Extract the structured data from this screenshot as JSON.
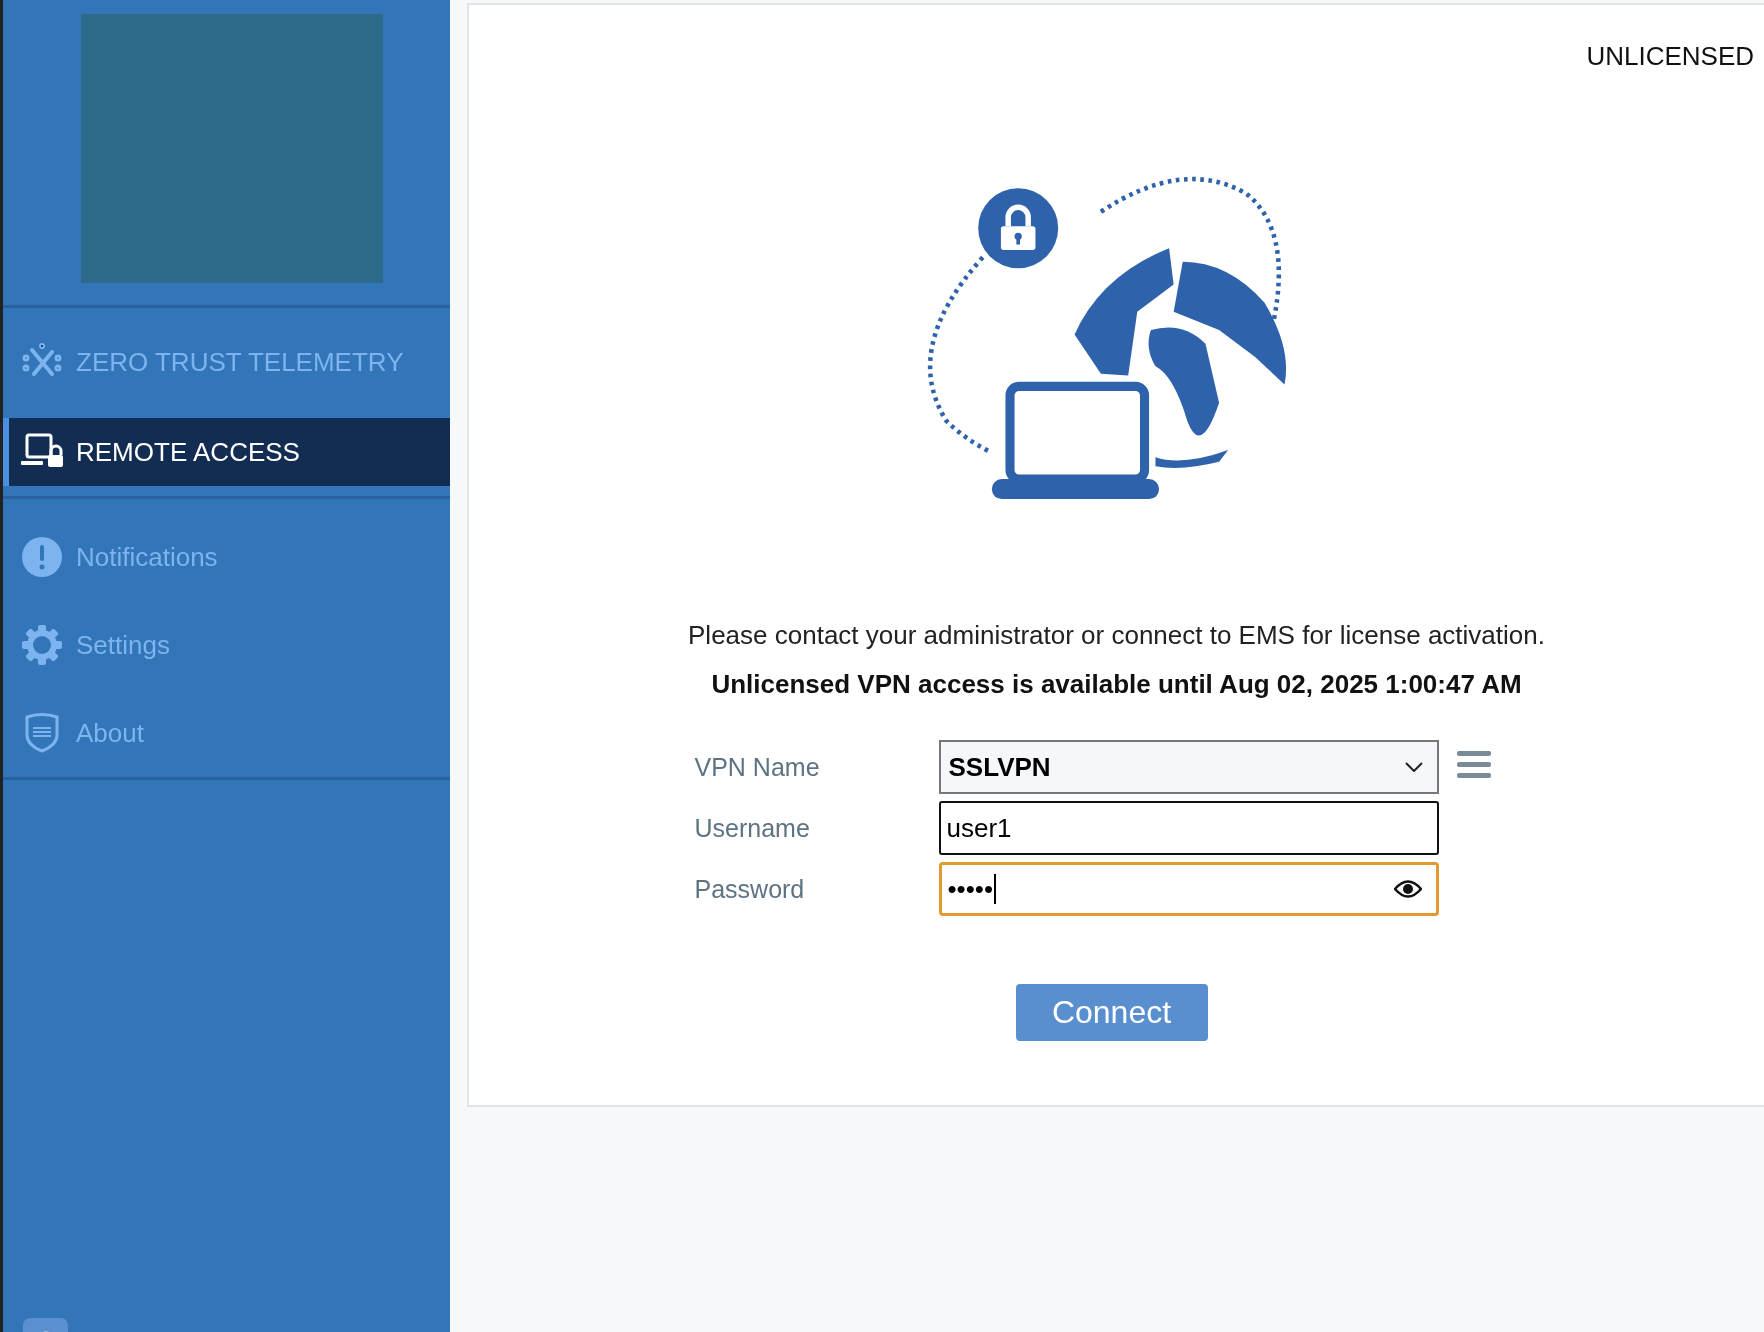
{
  "status_badge": "UNLICENSED",
  "sidebar": {
    "items": [
      {
        "label": "ZERO TRUST TELEMETRY",
        "kind": "telemetry",
        "selected": false
      },
      {
        "label": "REMOTE ACCESS",
        "kind": "remote",
        "selected": true
      },
      {
        "label": "Notifications",
        "kind": "notifications",
        "selected": false
      },
      {
        "label": "Settings",
        "kind": "settings",
        "selected": false
      },
      {
        "label": "About",
        "kind": "about",
        "selected": false
      }
    ]
  },
  "message": "Please contact your administrator or connect to EMS for license activation.",
  "notice": "Unlicensed VPN access is available until Aug 02, 2025 1:00:47 AM",
  "form": {
    "fields": [
      {
        "label": "VPN Name",
        "kind": "select",
        "value": "SSLVPN",
        "focused": false
      },
      {
        "label": "Username",
        "kind": "text",
        "value": "user1",
        "focused": false
      },
      {
        "label": "Password",
        "kind": "password",
        "value": "•••••",
        "focused": true
      }
    ]
  },
  "connect_button": "Connect"
}
